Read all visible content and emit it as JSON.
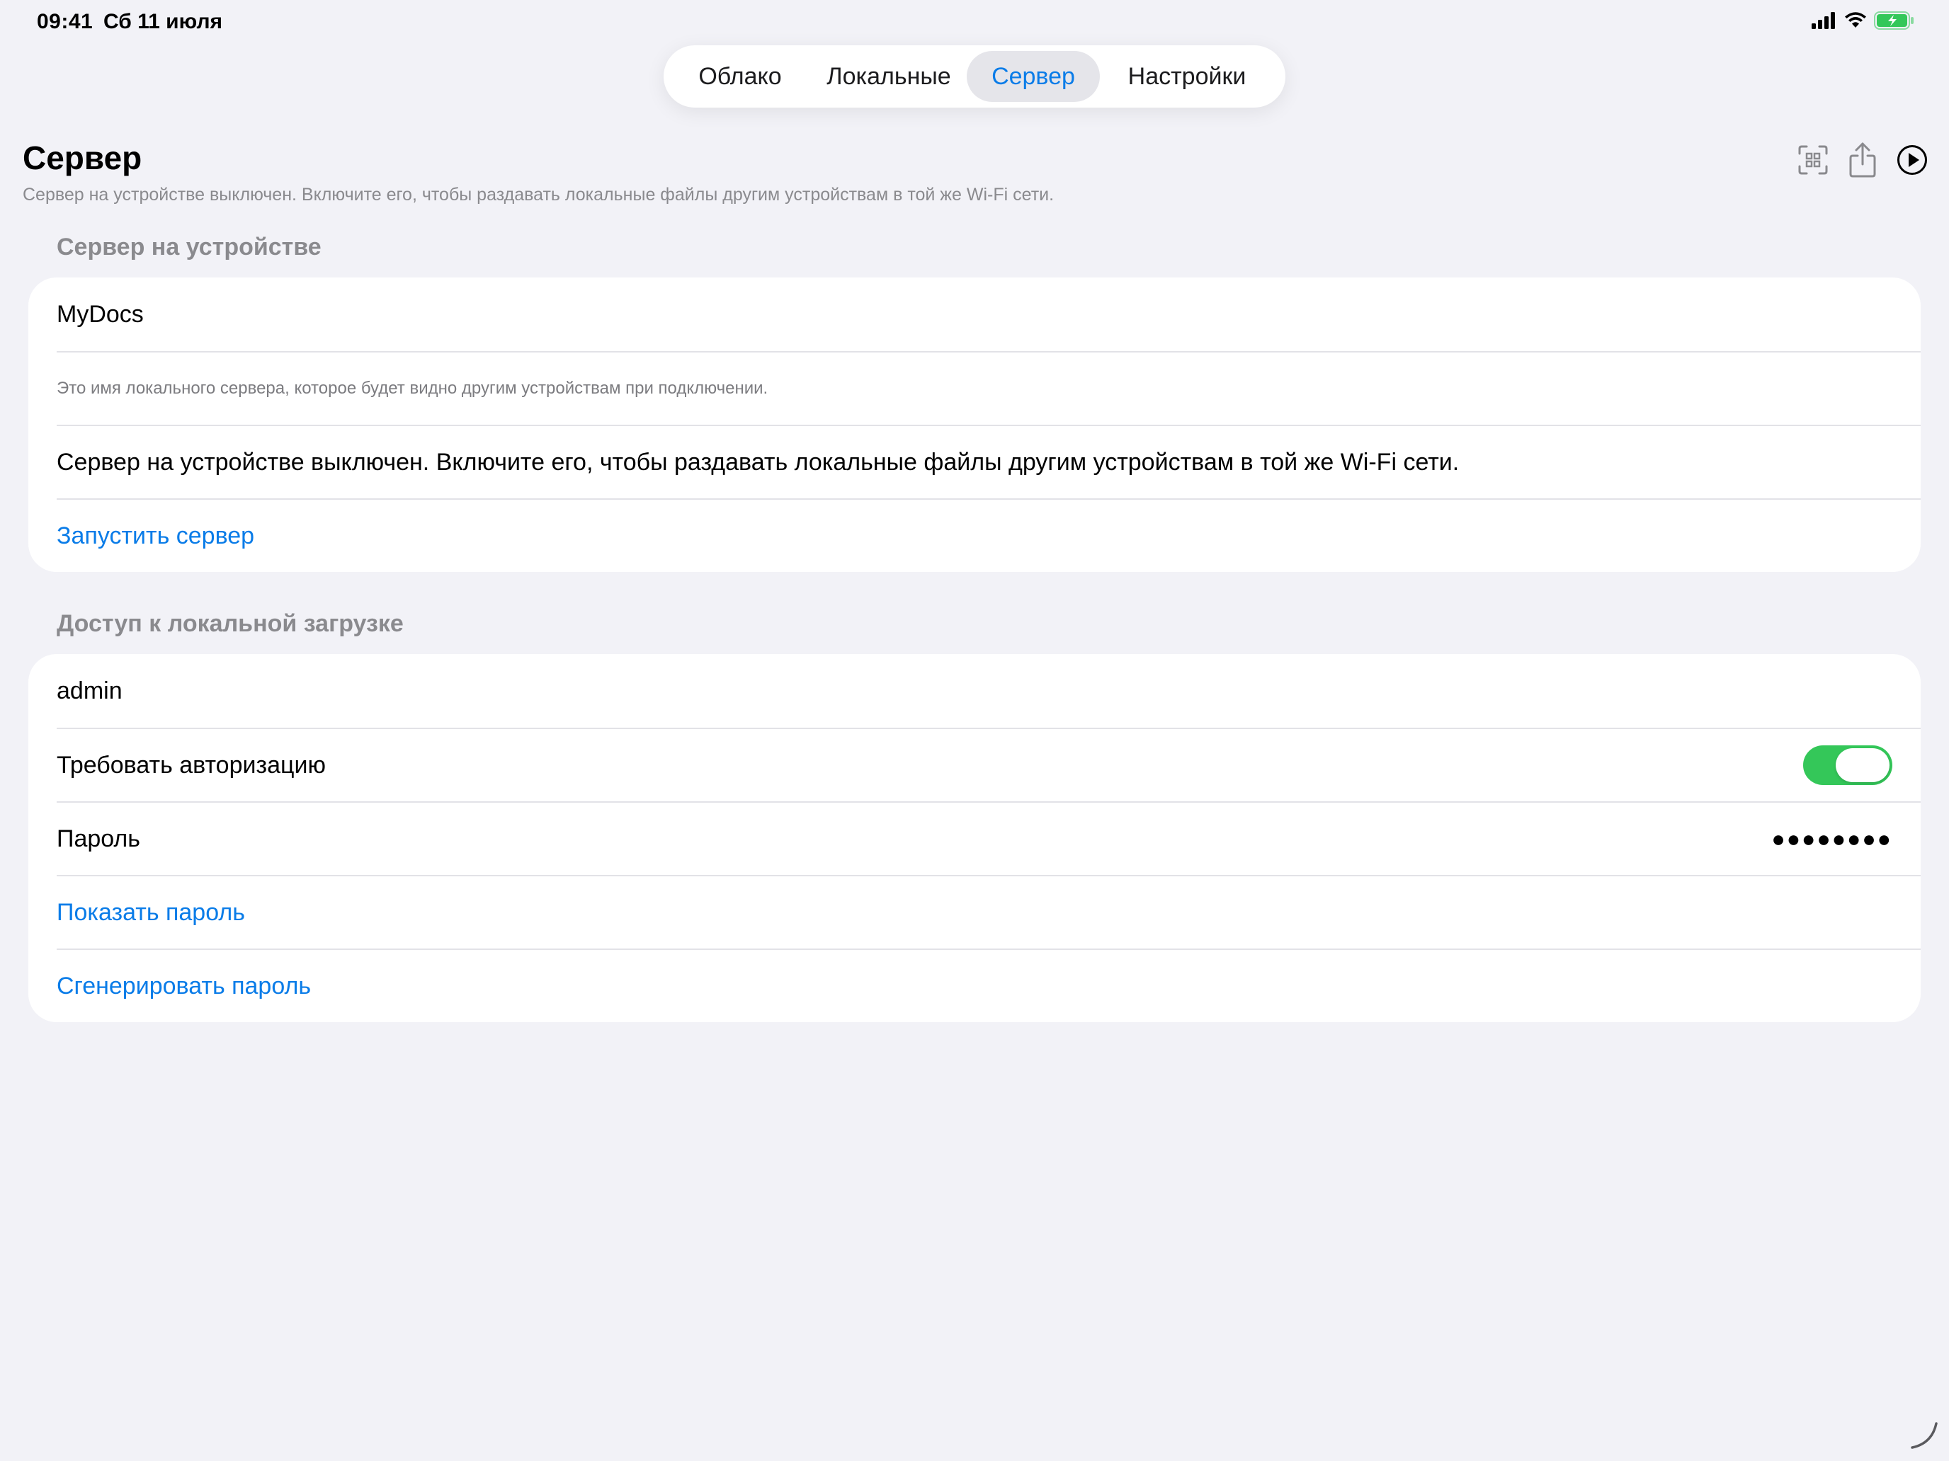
{
  "status_bar": {
    "time": "09:41",
    "date": "Сб 11 июля",
    "icons": [
      "cellular-signal-icon",
      "wifi-icon",
      "battery-charging-icon"
    ],
    "battery_color": "#34c759"
  },
  "tabs": [
    {
      "label": "Облако",
      "active": false
    },
    {
      "label": "Локальные",
      "active": false
    },
    {
      "label": "Сервер",
      "active": true
    },
    {
      "label": "Настройки",
      "active": false
    }
  ],
  "header": {
    "title": "Сервер",
    "subtitle": "Сервер на устройстве выключен. Включите его, чтобы раздавать локальные файлы другим устройствам в той же Wi-Fi сети.",
    "actions": [
      "qr-code-scan-icon",
      "share-icon",
      "play-icon"
    ]
  },
  "server_section": {
    "header": "Сервер на устройстве",
    "server_name": "MyDocs",
    "name_note": "Это имя локального сервера, которое будет видно другим устройствам при подключении.",
    "status_text": "Сервер на устройстве выключен. Включите его, чтобы раздавать локальные файлы другим устройствам в той же Wi-Fi сети.",
    "start_button": "Запустить сервер"
  },
  "access_section": {
    "header": "Доступ к локальной загрузке",
    "username": "admin",
    "require_auth_label": "Требовать авторизацию",
    "require_auth_enabled": true,
    "password_label": "Пароль",
    "password_masked": "●●●●●●●●",
    "show_password_button": "Показать пароль",
    "generate_password_button": "Сгенерировать пароль"
  },
  "colors": {
    "accent": "#0a7ce8",
    "toggle_on": "#34c759",
    "background": "#f2f2f7"
  }
}
